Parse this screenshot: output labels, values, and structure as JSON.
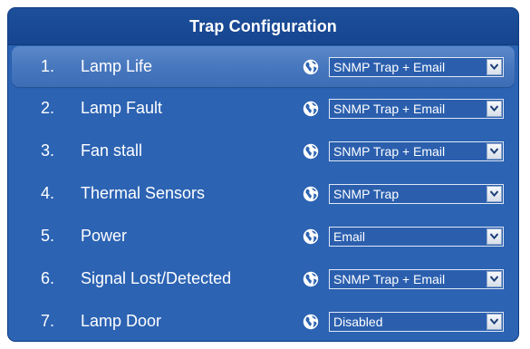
{
  "title": "Trap Configuration",
  "rows": [
    {
      "num": "1.",
      "label": "Lamp Life",
      "value": "SNMP Trap + Email",
      "selected": true
    },
    {
      "num": "2.",
      "label": "Lamp Fault",
      "value": "SNMP Trap + Email",
      "selected": false
    },
    {
      "num": "3.",
      "label": "Fan stall",
      "value": "SNMP Trap + Email",
      "selected": false
    },
    {
      "num": "4.",
      "label": "Thermal Sensors",
      "value": "SNMP Trap",
      "selected": false
    },
    {
      "num": "5.",
      "label": "Power",
      "value": "Email",
      "selected": false
    },
    {
      "num": "6.",
      "label": "Signal Lost/Detected",
      "value": "SNMP Trap + Email",
      "selected": false
    },
    {
      "num": "7.",
      "label": "Lamp Door",
      "value": "Disabled",
      "selected": false
    }
  ],
  "icons": {
    "row_icon": "globe-icon",
    "dropdown_icon": "chevron-down-icon"
  },
  "colors": {
    "panel_bg": "#2c63b3",
    "title_bg": "#1d4f9a",
    "selected_row_bg": "#4676bd",
    "text": "#ffffff"
  }
}
